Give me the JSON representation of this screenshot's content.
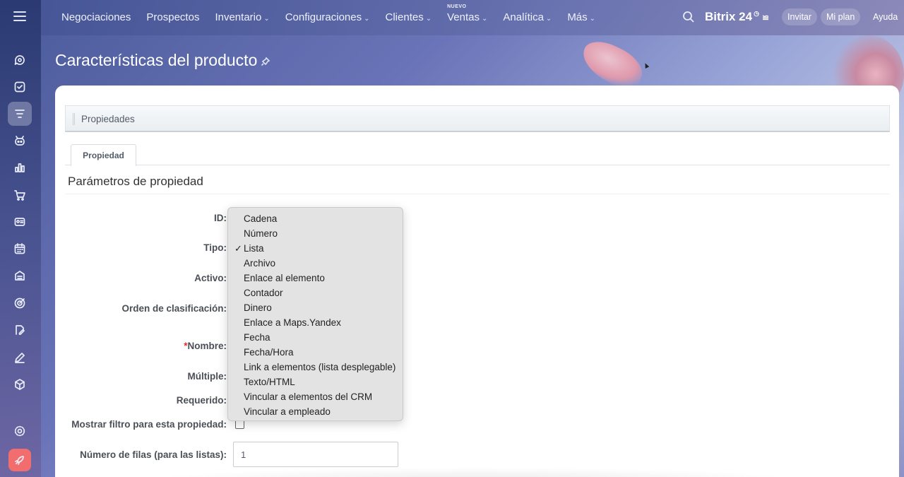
{
  "topbar": {
    "nav": [
      {
        "label": "Negociaciones",
        "chevron": false,
        "tag": ""
      },
      {
        "label": "Prospectos",
        "chevron": false,
        "tag": ""
      },
      {
        "label": "Inventario",
        "chevron": true,
        "tag": ""
      },
      {
        "label": "Configuraciones",
        "chevron": true,
        "tag": ""
      },
      {
        "label": "Clientes",
        "chevron": true,
        "tag": ""
      },
      {
        "label": "Ventas",
        "chevron": true,
        "tag": "NUEVO"
      },
      {
        "label": "Analítica",
        "chevron": true,
        "tag": ""
      },
      {
        "label": "Más",
        "chevron": true,
        "tag": ""
      }
    ],
    "brand": "Bitrix 24",
    "invite_label": "Invitar",
    "plan_label": "Mi plan",
    "help_label": "Ayuda"
  },
  "sidebar": {
    "icons": [
      "chat-icon",
      "tasks-icon",
      "crm-icon",
      "copilot-icon",
      "analytics-icon",
      "shop-icon",
      "contact-center-icon",
      "calendar-icon",
      "inventory-icon",
      "marketing-icon",
      "sign-icon",
      "edit-icon",
      "package-icon",
      "settings-icon",
      "rocket-icon"
    ]
  },
  "page": {
    "title": "Características del producto",
    "properties_bar": "Propiedades",
    "tab": "Propiedad",
    "section_title": "Parámetros de propiedad"
  },
  "form": {
    "id_label": "ID:",
    "type_label": "Tipo:",
    "active_label": "Activo:",
    "sort_label": "Orden de clasificación:",
    "name_required_mark": "*",
    "name_label": "Nombre:",
    "multiple_label": "Múltiple:",
    "required_label": "Requerido:",
    "filter_label": "Mostrar filtro para esta propiedad:",
    "rows_label": "Número de filas (para las listas):",
    "rows_value": "1"
  },
  "type_dropdown": {
    "selected": "Lista",
    "options": [
      "Cadena",
      "Número",
      "Lista",
      "Archivo",
      "Enlace al elemento",
      "Contador",
      "Dinero",
      "Enlace a Maps.Yandex",
      "Fecha",
      "Fecha/Hora",
      "Link a elementos (lista desplegable)",
      "Texto/HTML",
      "Vincular a elementos del CRM",
      "Vincular a empleado"
    ]
  }
}
